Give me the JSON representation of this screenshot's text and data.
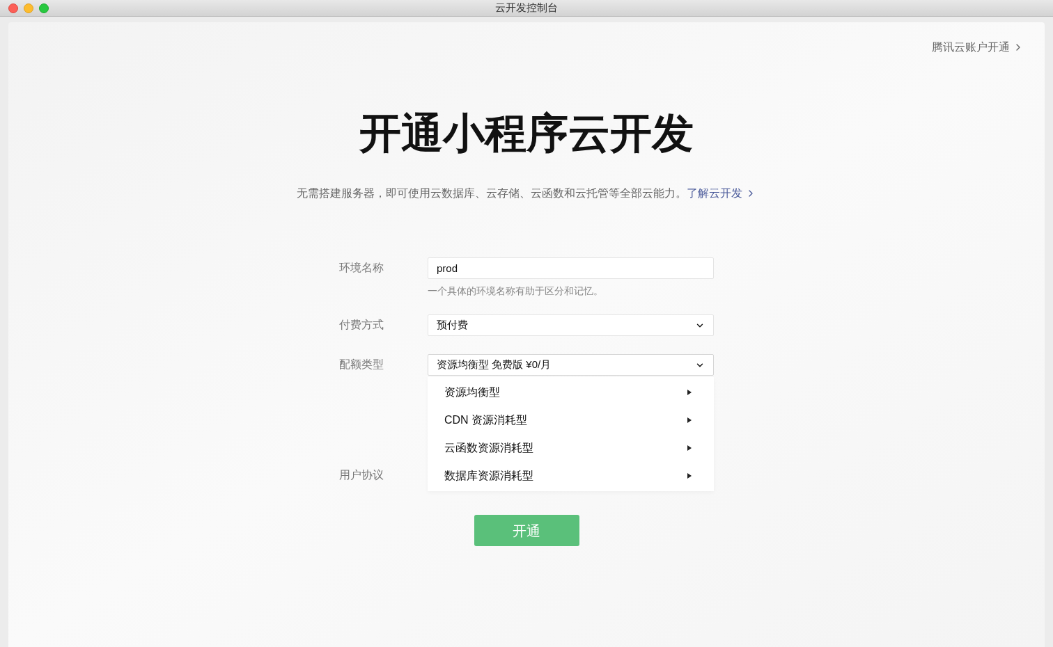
{
  "window": {
    "title": "云开发控制台"
  },
  "account_link": "腾讯云账户开通",
  "heading": "开通小程序云开发",
  "subtitle": {
    "text": "无需搭建服务器，即可使用云数据库、云存储、云函数和云托管等全部云能力。",
    "link": "了解云开发"
  },
  "form": [
    {
      "kind": "input",
      "label": "环境名称",
      "value": "prod",
      "hint": "一个具体的环境名称有助于区分和记忆。"
    },
    {
      "kind": "select",
      "label": "付费方式",
      "value": "预付费",
      "expanded": false
    },
    {
      "kind": "select",
      "label": "配额类型",
      "value": "资源均衡型 免费版 ¥0/月",
      "expanded": true,
      "options": [
        "资源均衡型",
        "CDN 资源消耗型",
        "云函数资源消耗型",
        "数据库资源消耗型"
      ]
    },
    {
      "kind": "label",
      "label": "用户协议"
    }
  ],
  "submit": "开通"
}
